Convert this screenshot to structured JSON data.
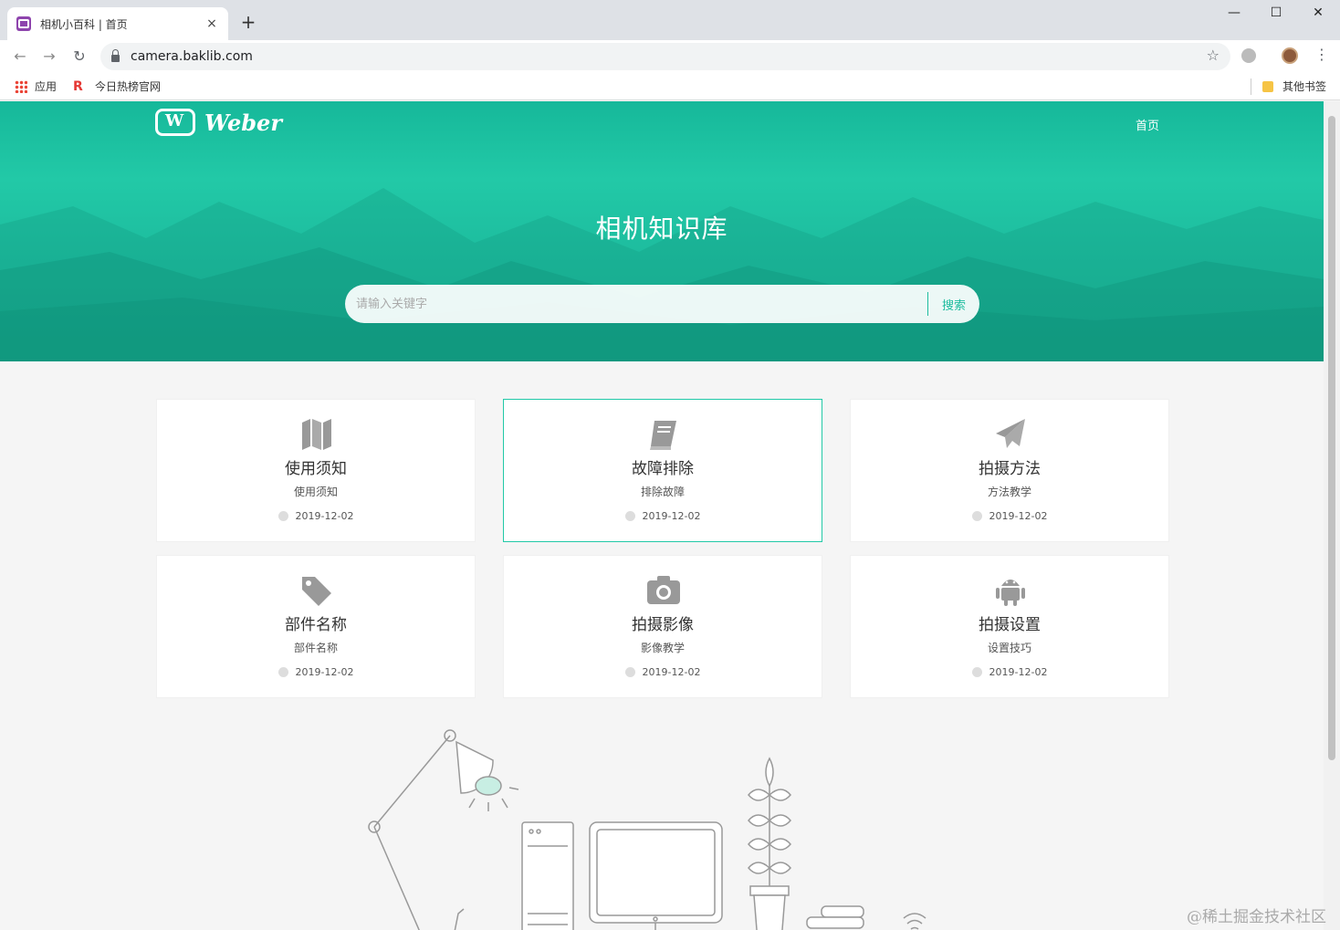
{
  "browser": {
    "tab_title": "相机小百科 | 首页",
    "tab_close": "×",
    "new_tab": "+",
    "minimize": "—",
    "maximize": "☐",
    "close": "✕",
    "back": "←",
    "forward": "→",
    "reload": "↻",
    "url": "camera.baklib.com",
    "star": "☆",
    "menu": "⋮",
    "bookmarks": {
      "apps": "应用",
      "hot": "今日热榜官网",
      "other": "其他书签"
    }
  },
  "site": {
    "logo_text": "Weber",
    "nav_home": "首页",
    "hero_title": "相机知识库",
    "search_placeholder": "请输入关键字",
    "search_button": "搜索"
  },
  "cards": [
    {
      "icon": "map-icon",
      "title": "使用须知",
      "subtitle": "使用须知",
      "date": "2019-12-02"
    },
    {
      "icon": "book-icon",
      "title": "故障排除",
      "subtitle": "排除故障",
      "date": "2019-12-02"
    },
    {
      "icon": "paper-plane-icon",
      "title": "拍摄方法",
      "subtitle": "方法教学",
      "date": "2019-12-02"
    },
    {
      "icon": "tags-icon",
      "title": "部件名称",
      "subtitle": "部件名称",
      "date": "2019-12-02"
    },
    {
      "icon": "camera-icon",
      "title": "拍摄影像",
      "subtitle": "影像教学",
      "date": "2019-12-02"
    },
    {
      "icon": "android-icon",
      "title": "拍摄设置",
      "subtitle": "设置技巧",
      "date": "2019-12-02"
    }
  ],
  "watermark": "@稀土掘金技术社区",
  "colors": {
    "brand": "#1dbc9e",
    "active_border": "#22c9a7"
  }
}
